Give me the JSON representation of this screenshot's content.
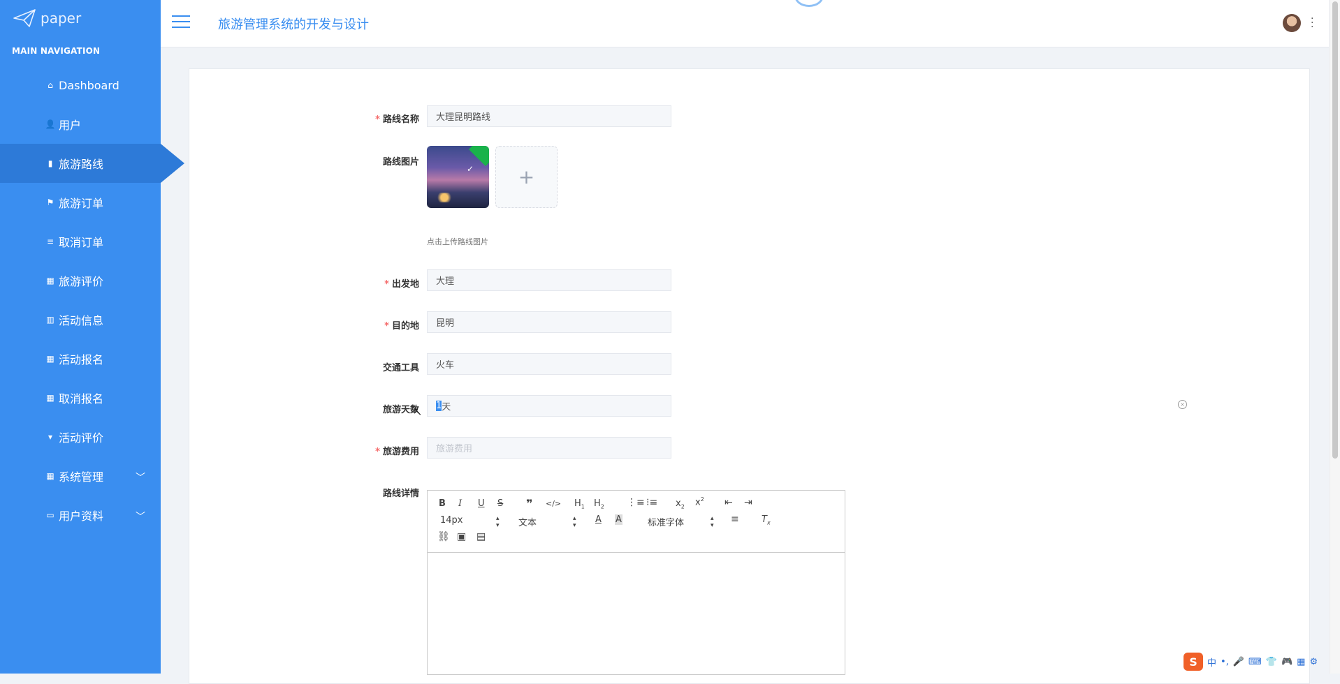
{
  "brand": {
    "logo_text": "paper"
  },
  "sidebar": {
    "section_title": "MAIN NAVIGATION",
    "items": [
      {
        "label": "Dashboard",
        "icon": "home-icon",
        "glyph": "⌂"
      },
      {
        "label": "用户",
        "icon": "user-icon",
        "glyph": "👤"
      },
      {
        "label": "旅游路线",
        "icon": "book-icon",
        "glyph": "▮",
        "active": true
      },
      {
        "label": "旅游订单",
        "icon": "flag-icon",
        "glyph": "⚑"
      },
      {
        "label": "取消订单",
        "icon": "sliders-icon",
        "glyph": "≡"
      },
      {
        "label": "旅游评价",
        "icon": "grid-icon",
        "glyph": "▦"
      },
      {
        "label": "活动信息",
        "icon": "bar-chart-icon",
        "glyph": "▥"
      },
      {
        "label": "活动报名",
        "icon": "grid-icon",
        "glyph": "▦"
      },
      {
        "label": "取消报名",
        "icon": "grid-icon",
        "glyph": "▦"
      },
      {
        "label": "活动评价",
        "icon": "cup-icon",
        "glyph": "▾"
      },
      {
        "label": "系统管理",
        "icon": "grid-icon",
        "glyph": "▦",
        "expandable": true
      },
      {
        "label": "用户资料",
        "icon": "card-icon",
        "glyph": "▭",
        "expandable": true
      }
    ]
  },
  "header": {
    "title": "旅游管理系统的开发与设计"
  },
  "form": {
    "route_name": {
      "label": "路线名称",
      "required": true,
      "value": "大理昆明路线"
    },
    "route_image": {
      "label": "路线图片",
      "hint": "点击上传路线图片",
      "add_glyph": "+"
    },
    "origin": {
      "label": "出发地",
      "required": true,
      "value": "大理"
    },
    "destination": {
      "label": "目的地",
      "required": true,
      "value": "昆明"
    },
    "transport": {
      "label": "交通工具",
      "required": false,
      "value": "火车"
    },
    "days": {
      "label": "旅游天数",
      "required": false,
      "value_selected": "1",
      "value_rest": "天"
    },
    "cost": {
      "label": "旅游费用",
      "required": true,
      "placeholder": "旅游费用"
    },
    "details": {
      "label": "路线详情"
    }
  },
  "editor": {
    "font_size": "14px",
    "text_type": "文本",
    "font_family": "标准字体"
  },
  "ime": {
    "logo": "S",
    "lang": "中",
    "punct": "•,"
  },
  "colors": {
    "sidebar": "#3a8ef0",
    "sidebar_active": "#2d7ad8",
    "accent": "#3a8ef0",
    "required": "#f56c6c"
  }
}
